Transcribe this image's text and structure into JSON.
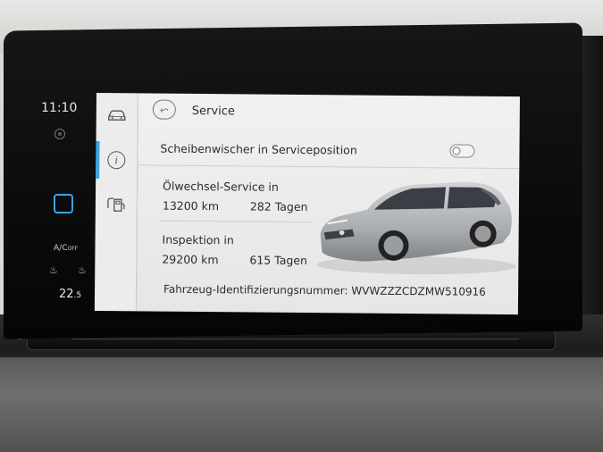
{
  "status": {
    "clock": "11:10",
    "ac_label": "A/C",
    "ac_state": "OFF",
    "temperature_main": "22",
    "temperature_decimal": ".5"
  },
  "side_nav": {
    "items": [
      {
        "icon": "car-icon"
      },
      {
        "icon": "info-icon",
        "symbol": "i",
        "active": true
      },
      {
        "icon": "fuel-pump-icon"
      }
    ]
  },
  "header": {
    "title": "Service"
  },
  "wiper": {
    "label": "Scheibenwischer in Serviceposition",
    "enabled": false
  },
  "oil_service": {
    "label": "Ölwechsel-Service in",
    "distance": "13200 km",
    "days": "282 Tagen"
  },
  "inspection": {
    "label": "Inspektion in",
    "distance": "29200 km",
    "days": "615 Tagen"
  },
  "vin": {
    "text": "Fahrzeug-Identifizierungsnummer: WVWZZZCDZMW510916"
  },
  "colors": {
    "accent": "#39a6e6",
    "screen_bg": "#ececec"
  }
}
